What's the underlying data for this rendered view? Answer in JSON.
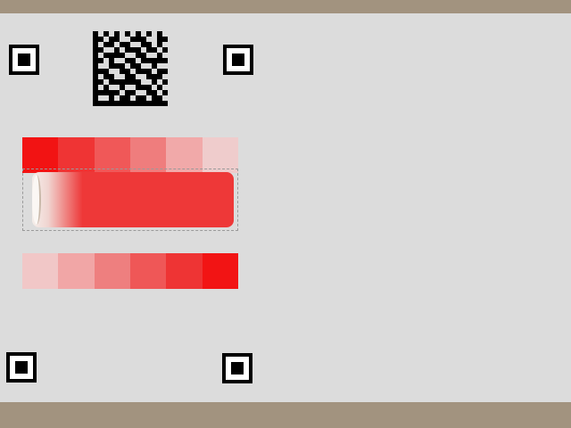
{
  "colors": {
    "background": "#a2937f",
    "sheet": "#dcdcdc",
    "accent": "#ee3838"
  },
  "markers": [
    {
      "icon": "fiducial-marker-icon"
    },
    {
      "icon": "fiducial-marker-icon"
    },
    {
      "icon": "fiducial-marker-icon"
    },
    {
      "icon": "fiducial-marker-icon"
    }
  ],
  "code": {
    "icon": "datamatrix-code-icon"
  },
  "swatches": {
    "top": [
      "#f21313",
      "#ef3434",
      "#f05858",
      "#ef7d7d",
      "#f1a9a9",
      "#efcccc"
    ],
    "bottom": [
      "#f1c7c7",
      "#f1a6a6",
      "#ee7f7f",
      "#ef5757",
      "#ee3434",
      "#f21414"
    ]
  },
  "slider": {
    "fill_color": "#ee3838"
  }
}
